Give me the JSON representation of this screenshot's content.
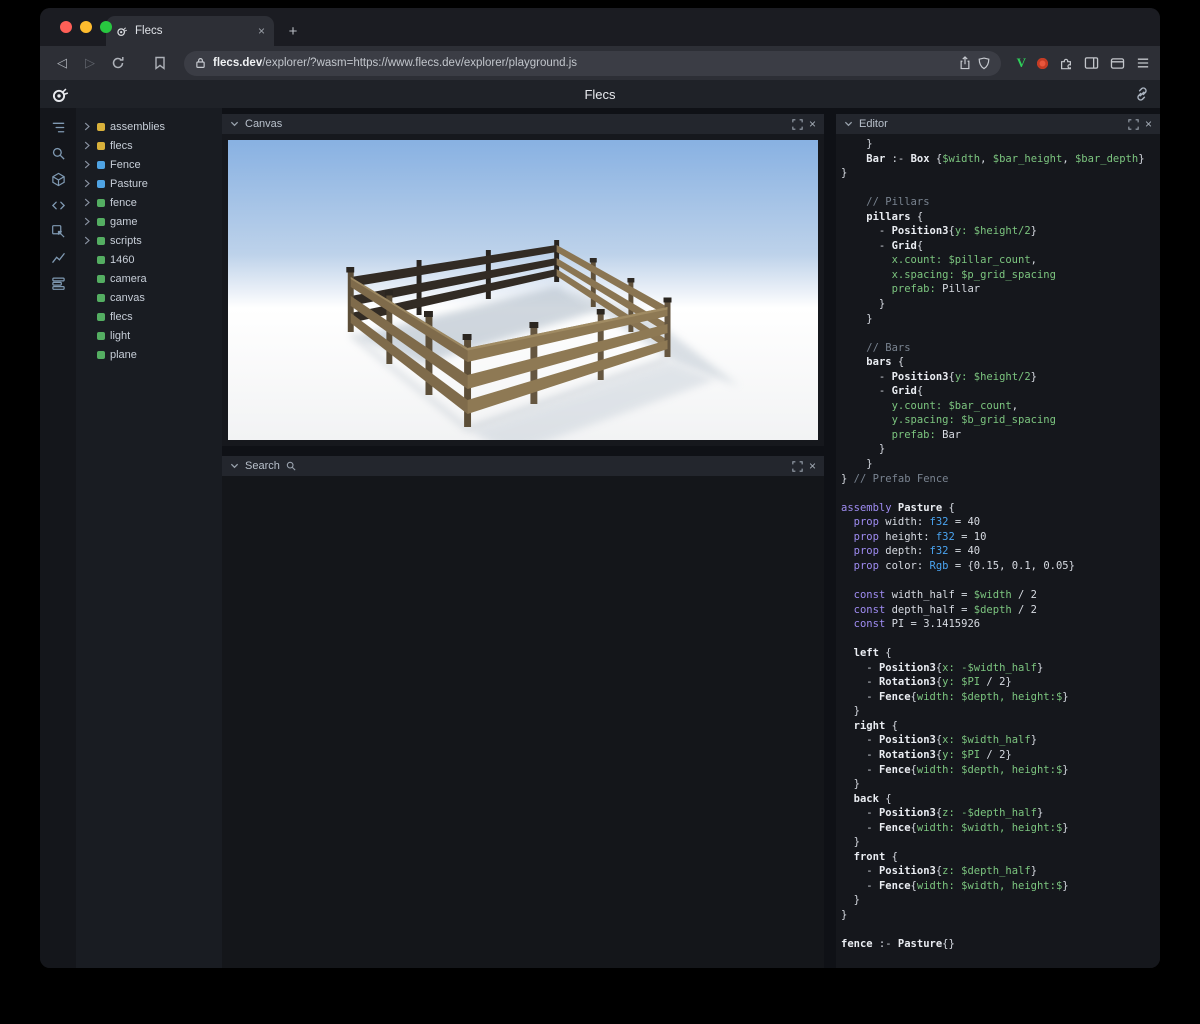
{
  "glyphs": {
    "close": "×",
    "plus": "+"
  },
  "window": {
    "tab_title": "Flecs",
    "url_domain": "flecs.dev",
    "url_path": "/explorer/?wasm=https://www.flecs.dev/explorer/playground.js"
  },
  "app": {
    "header_title": "Flecs"
  },
  "icon_rail": {
    "items": [
      {
        "icon": "entity-tree"
      },
      {
        "icon": "search"
      },
      {
        "icon": "scene"
      },
      {
        "icon": "code"
      },
      {
        "icon": "inspect"
      },
      {
        "icon": "stats"
      },
      {
        "icon": "queries"
      }
    ]
  },
  "tree": {
    "items": [
      {
        "label": "assemblies",
        "color": "#d9b13b",
        "expandable": true
      },
      {
        "label": "flecs",
        "color": "#d9b13b",
        "expandable": true
      },
      {
        "label": "Fence",
        "color": "#4fa3e3",
        "expandable": true
      },
      {
        "label": "Pasture",
        "color": "#4fa3e3",
        "expandable": true
      },
      {
        "label": "fence",
        "color": "#54ae62",
        "expandable": true
      },
      {
        "label": "game",
        "color": "#54ae62",
        "expandable": true
      },
      {
        "label": "scripts",
        "color": "#54ae62",
        "expandable": true
      },
      {
        "label": "1460",
        "color": "#54ae62",
        "expandable": false
      },
      {
        "label": "camera",
        "color": "#54ae62",
        "expandable": false
      },
      {
        "label": "canvas",
        "color": "#54ae62",
        "expandable": false
      },
      {
        "label": "flecs",
        "color": "#54ae62",
        "expandable": false
      },
      {
        "label": "light",
        "color": "#54ae62",
        "expandable": false
      },
      {
        "label": "plane",
        "color": "#54ae62",
        "expandable": false
      }
    ]
  },
  "panels": {
    "canvas": {
      "title": "Canvas"
    },
    "search": {
      "title": "Search"
    },
    "editor": {
      "title": "Editor"
    }
  },
  "editor": {
    "code_lines": [
      [
        [
          "    }",
          "p"
        ]
      ],
      [
        [
          "    ",
          "p"
        ],
        [
          "Bar",
          "b"
        ],
        [
          " :- ",
          "p"
        ],
        [
          "Box",
          "b"
        ],
        [
          " {",
          "p"
        ],
        [
          "$width",
          "v"
        ],
        [
          ", ",
          "p"
        ],
        [
          "$bar_height",
          "v"
        ],
        [
          ", ",
          "p"
        ],
        [
          "$bar_depth",
          "v"
        ],
        [
          "}",
          "p"
        ]
      ],
      [
        [
          "}",
          "p"
        ]
      ],
      [],
      [
        [
          "    ",
          "p"
        ],
        [
          "// Pillars",
          "c"
        ]
      ],
      [
        [
          "    ",
          "p"
        ],
        [
          "pillars",
          "b"
        ],
        [
          " {",
          "p"
        ]
      ],
      [
        [
          "      - ",
          "p"
        ],
        [
          "Position3",
          "b"
        ],
        [
          "{",
          "p"
        ],
        [
          "y: $height/2",
          "v"
        ],
        [
          "}",
          "p"
        ]
      ],
      [
        [
          "      - ",
          "p"
        ],
        [
          "Grid",
          "b"
        ],
        [
          "{",
          "p"
        ]
      ],
      [
        [
          "        ",
          "p"
        ],
        [
          "x.count: $pillar_count",
          "v"
        ],
        [
          ",",
          "p"
        ]
      ],
      [
        [
          "        ",
          "p"
        ],
        [
          "x.spacing: $p_grid_spacing",
          "v"
        ]
      ],
      [
        [
          "        ",
          "p"
        ],
        [
          "prefab: ",
          "v"
        ],
        [
          "Pillar",
          "p"
        ]
      ],
      [
        [
          "      }",
          "p"
        ]
      ],
      [
        [
          "    }",
          "p"
        ]
      ],
      [],
      [
        [
          "    ",
          "p"
        ],
        [
          "// Bars",
          "c"
        ]
      ],
      [
        [
          "    ",
          "p"
        ],
        [
          "bars",
          "b"
        ],
        [
          " {",
          "p"
        ]
      ],
      [
        [
          "      - ",
          "p"
        ],
        [
          "Position3",
          "b"
        ],
        [
          "{",
          "p"
        ],
        [
          "y: $height/2",
          "v"
        ],
        [
          "}",
          "p"
        ]
      ],
      [
        [
          "      - ",
          "p"
        ],
        [
          "Grid",
          "b"
        ],
        [
          "{",
          "p"
        ]
      ],
      [
        [
          "        ",
          "p"
        ],
        [
          "y.count: $bar_count",
          "v"
        ],
        [
          ",",
          "p"
        ]
      ],
      [
        [
          "        ",
          "p"
        ],
        [
          "y.spacing: $b_grid_spacing",
          "v"
        ]
      ],
      [
        [
          "        ",
          "p"
        ],
        [
          "prefab: ",
          "v"
        ],
        [
          "Bar",
          "p"
        ]
      ],
      [
        [
          "      }",
          "p"
        ]
      ],
      [
        [
          "    }",
          "p"
        ]
      ],
      [
        [
          "} ",
          "p"
        ],
        [
          "// Prefab Fence",
          "c"
        ]
      ],
      [],
      [
        [
          "assembly",
          "k"
        ],
        [
          " ",
          "p"
        ],
        [
          "Pasture",
          "b"
        ],
        [
          " {",
          "p"
        ]
      ],
      [
        [
          "  ",
          "p"
        ],
        [
          "prop",
          "k"
        ],
        [
          " width: ",
          "p"
        ],
        [
          "f32",
          "t"
        ],
        [
          " = 40",
          "p"
        ]
      ],
      [
        [
          "  ",
          "p"
        ],
        [
          "prop",
          "k"
        ],
        [
          " height: ",
          "p"
        ],
        [
          "f32",
          "t"
        ],
        [
          " = 10",
          "p"
        ]
      ],
      [
        [
          "  ",
          "p"
        ],
        [
          "prop",
          "k"
        ],
        [
          " depth: ",
          "p"
        ],
        [
          "f32",
          "t"
        ],
        [
          " = 40",
          "p"
        ]
      ],
      [
        [
          "  ",
          "p"
        ],
        [
          "prop",
          "k"
        ],
        [
          " color: ",
          "p"
        ],
        [
          "Rgb",
          "t"
        ],
        [
          " = {0.15, 0.1, 0.05}",
          "p"
        ]
      ],
      [],
      [
        [
          "  ",
          "p"
        ],
        [
          "const",
          "k"
        ],
        [
          " width_half = ",
          "p"
        ],
        [
          "$width",
          "v"
        ],
        [
          " / 2",
          "p"
        ]
      ],
      [
        [
          "  ",
          "p"
        ],
        [
          "const",
          "k"
        ],
        [
          " depth_half = ",
          "p"
        ],
        [
          "$depth",
          "v"
        ],
        [
          " / 2",
          "p"
        ]
      ],
      [
        [
          "  ",
          "p"
        ],
        [
          "const",
          "k"
        ],
        [
          " PI = 3.1415926",
          "p"
        ]
      ],
      [],
      [
        [
          "  ",
          "p"
        ],
        [
          "left",
          "b"
        ],
        [
          " {",
          "p"
        ]
      ],
      [
        [
          "    - ",
          "p"
        ],
        [
          "Position3",
          "b"
        ],
        [
          "{",
          "p"
        ],
        [
          "x: -$width_half",
          "v"
        ],
        [
          "}",
          "p"
        ]
      ],
      [
        [
          "    - ",
          "p"
        ],
        [
          "Rotation3",
          "b"
        ],
        [
          "{",
          "p"
        ],
        [
          "y: $PI",
          "v"
        ],
        [
          " / 2}",
          "p"
        ]
      ],
      [
        [
          "    - ",
          "p"
        ],
        [
          "Fence",
          "b"
        ],
        [
          "{",
          "p"
        ],
        [
          "width: $depth, height:$",
          "v"
        ],
        [
          "}",
          "p"
        ]
      ],
      [
        [
          "  }",
          "p"
        ]
      ],
      [
        [
          "  ",
          "p"
        ],
        [
          "right",
          "b"
        ],
        [
          " {",
          "p"
        ]
      ],
      [
        [
          "    - ",
          "p"
        ],
        [
          "Position3",
          "b"
        ],
        [
          "{",
          "p"
        ],
        [
          "x: $width_half",
          "v"
        ],
        [
          "}",
          "p"
        ]
      ],
      [
        [
          "    - ",
          "p"
        ],
        [
          "Rotation3",
          "b"
        ],
        [
          "{",
          "p"
        ],
        [
          "y: $PI",
          "v"
        ],
        [
          " / 2}",
          "p"
        ]
      ],
      [
        [
          "    - ",
          "p"
        ],
        [
          "Fence",
          "b"
        ],
        [
          "{",
          "p"
        ],
        [
          "width: $depth, height:$",
          "v"
        ],
        [
          "}",
          "p"
        ]
      ],
      [
        [
          "  }",
          "p"
        ]
      ],
      [
        [
          "  ",
          "p"
        ],
        [
          "back",
          "b"
        ],
        [
          " {",
          "p"
        ]
      ],
      [
        [
          "    - ",
          "p"
        ],
        [
          "Position3",
          "b"
        ],
        [
          "{",
          "p"
        ],
        [
          "z: -$depth_half",
          "v"
        ],
        [
          "}",
          "p"
        ]
      ],
      [
        [
          "    - ",
          "p"
        ],
        [
          "Fence",
          "b"
        ],
        [
          "{",
          "p"
        ],
        [
          "width: $width, height:$",
          "v"
        ],
        [
          "}",
          "p"
        ]
      ],
      [
        [
          "  }",
          "p"
        ]
      ],
      [
        [
          "  ",
          "p"
        ],
        [
          "front",
          "b"
        ],
        [
          " {",
          "p"
        ]
      ],
      [
        [
          "    - ",
          "p"
        ],
        [
          "Position3",
          "b"
        ],
        [
          "{",
          "p"
        ],
        [
          "z: $depth_half",
          "v"
        ],
        [
          "}",
          "p"
        ]
      ],
      [
        [
          "    - ",
          "p"
        ],
        [
          "Fence",
          "b"
        ],
        [
          "{",
          "p"
        ],
        [
          "width: $width, height:$",
          "v"
        ],
        [
          "}",
          "p"
        ]
      ],
      [
        [
          "  }",
          "p"
        ]
      ],
      [
        [
          "}",
          "p"
        ]
      ],
      [],
      [
        [
          "fence",
          "b"
        ],
        [
          " :- ",
          "p"
        ],
        [
          "Pasture",
          "b"
        ],
        [
          "{}",
          "p"
        ]
      ]
    ]
  }
}
